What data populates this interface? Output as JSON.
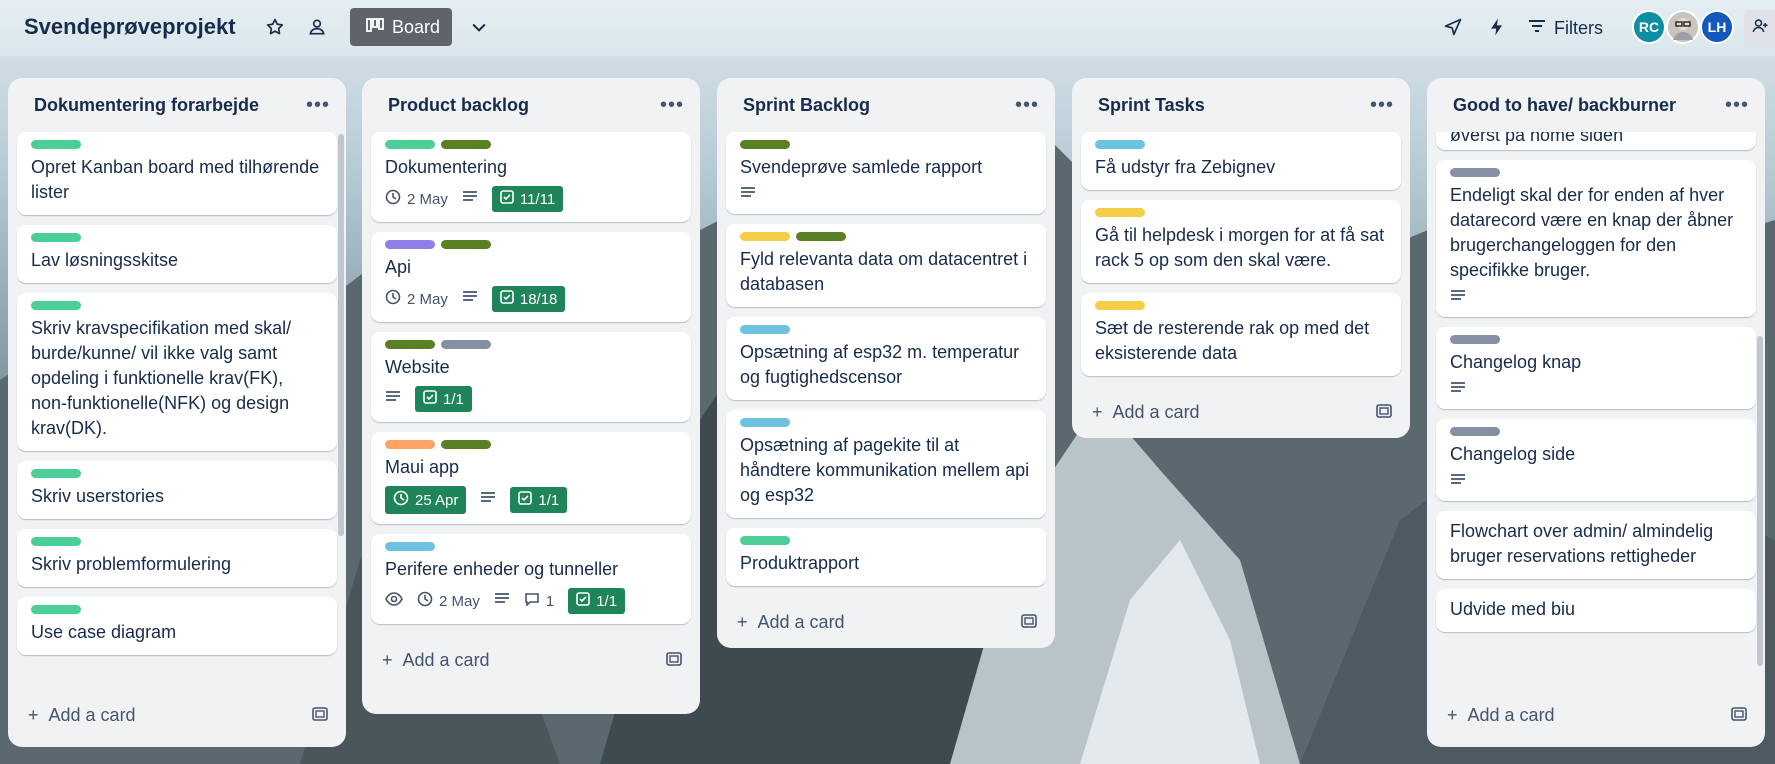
{
  "header": {
    "title": "Svendeprøveprojekt",
    "view_label": "Board",
    "filters_label": "Filters",
    "avatars": [
      {
        "initials": "RC",
        "color": "#0e8ea3"
      },
      {
        "initials": "",
        "color": "#c9c4bd"
      },
      {
        "initials": "LH",
        "color": "#1558bc"
      }
    ]
  },
  "lists": [
    {
      "title": "Dokumentering forarbejde",
      "add_label": "Add a card",
      "cards": [
        {
          "labels": [
            "#4bce97"
          ],
          "text": "Opret Kanban board med tilhørende lister"
        },
        {
          "labels": [
            "#4bce97"
          ],
          "text": "Lav løsningsskitse"
        },
        {
          "labels": [
            "#4bce97"
          ],
          "text": "Skriv kravspecifikation med skal/ burde/kunne/ vil ikke valg samt opdeling i funktionelle krav(FK), non-funktionelle(NFK) og design krav(DK)."
        },
        {
          "labels": [
            "#4bce97"
          ],
          "text": "Skriv userstories"
        },
        {
          "labels": [
            "#4bce97"
          ],
          "text": "Skriv problemformulering"
        },
        {
          "labels": [
            "#4bce97"
          ],
          "text": "Use case diagram"
        }
      ]
    },
    {
      "title": "Product backlog",
      "add_label": "Add a card",
      "cards": [
        {
          "labels": [
            "#4bce97",
            "#5b7f24"
          ],
          "text": "Dokumentering",
          "date": "2 May",
          "checklist": "11/11"
        },
        {
          "labels": [
            "#8f7ee7",
            "#5b7f24"
          ],
          "text": "Api",
          "date": "2 May",
          "checklist": "18/18"
        },
        {
          "labels": [
            "#5b7f24",
            "#8590a2"
          ],
          "text": "Website",
          "checklist": "1/1"
        },
        {
          "labels": [
            "#fea362",
            "#5b7f24"
          ],
          "text": "Maui app",
          "date": "25 Apr",
          "checklist": "1/1"
        },
        {
          "labels": [
            "#6cc3e0"
          ],
          "text": "Perifere enheder og tunneller",
          "date": "2 May",
          "comments": "1",
          "checklist": "1/1"
        }
      ]
    },
    {
      "title": "Sprint Backlog",
      "add_label": "Add a card",
      "cards": [
        {
          "labels": [
            "#5b7f24"
          ],
          "text": "Svendeprøve samlede rapport"
        },
        {
          "labels": [
            "#f5cd47",
            "#5b7f24"
          ],
          "text": "Fyld relevanta data om datacentret i databasen"
        },
        {
          "labels": [
            "#6cc3e0"
          ],
          "text": "Opsætning af esp32 m. temperatur og fugtighedscensor"
        },
        {
          "labels": [
            "#6cc3e0"
          ],
          "text": "Opsætning af pagekite til at håndtere kommunikation mellem api og esp32"
        },
        {
          "labels": [
            "#4bce97"
          ],
          "text": "Produktrapport"
        }
      ]
    },
    {
      "title": "Sprint Tasks",
      "add_label": "Add a card",
      "cards": [
        {
          "labels": [
            "#6cc3e0"
          ],
          "text": "Få udstyr fra Zebignev"
        },
        {
          "labels": [
            "#f5cd47"
          ],
          "text": "Gå til helpdesk i morgen for at få sat rack 5 op som den skal være."
        },
        {
          "labels": [
            "#f5cd47"
          ],
          "text": "Sæt de resterende rak op med det eksisterende data"
        }
      ]
    },
    {
      "title": "Good to have/ backburner",
      "add_label": "Add a card",
      "partial_text": "øverst på home siden",
      "cards": [
        {
          "labels": [
            "#8590a2"
          ],
          "text": "Endeligt skal der for enden af hver datarecord være en knap der åbner brugerchangeloggen for den specifikke bruger."
        },
        {
          "labels": [
            "#8590a2"
          ],
          "text": "Changelog knap"
        },
        {
          "labels": [
            "#8590a2"
          ],
          "text": "Changelog side"
        },
        {
          "labels": [],
          "text": "Flowchart over admin/ almindelig bruger reservations rettigheder"
        },
        {
          "labels": [],
          "text": "Udvide med biu"
        }
      ]
    }
  ]
}
